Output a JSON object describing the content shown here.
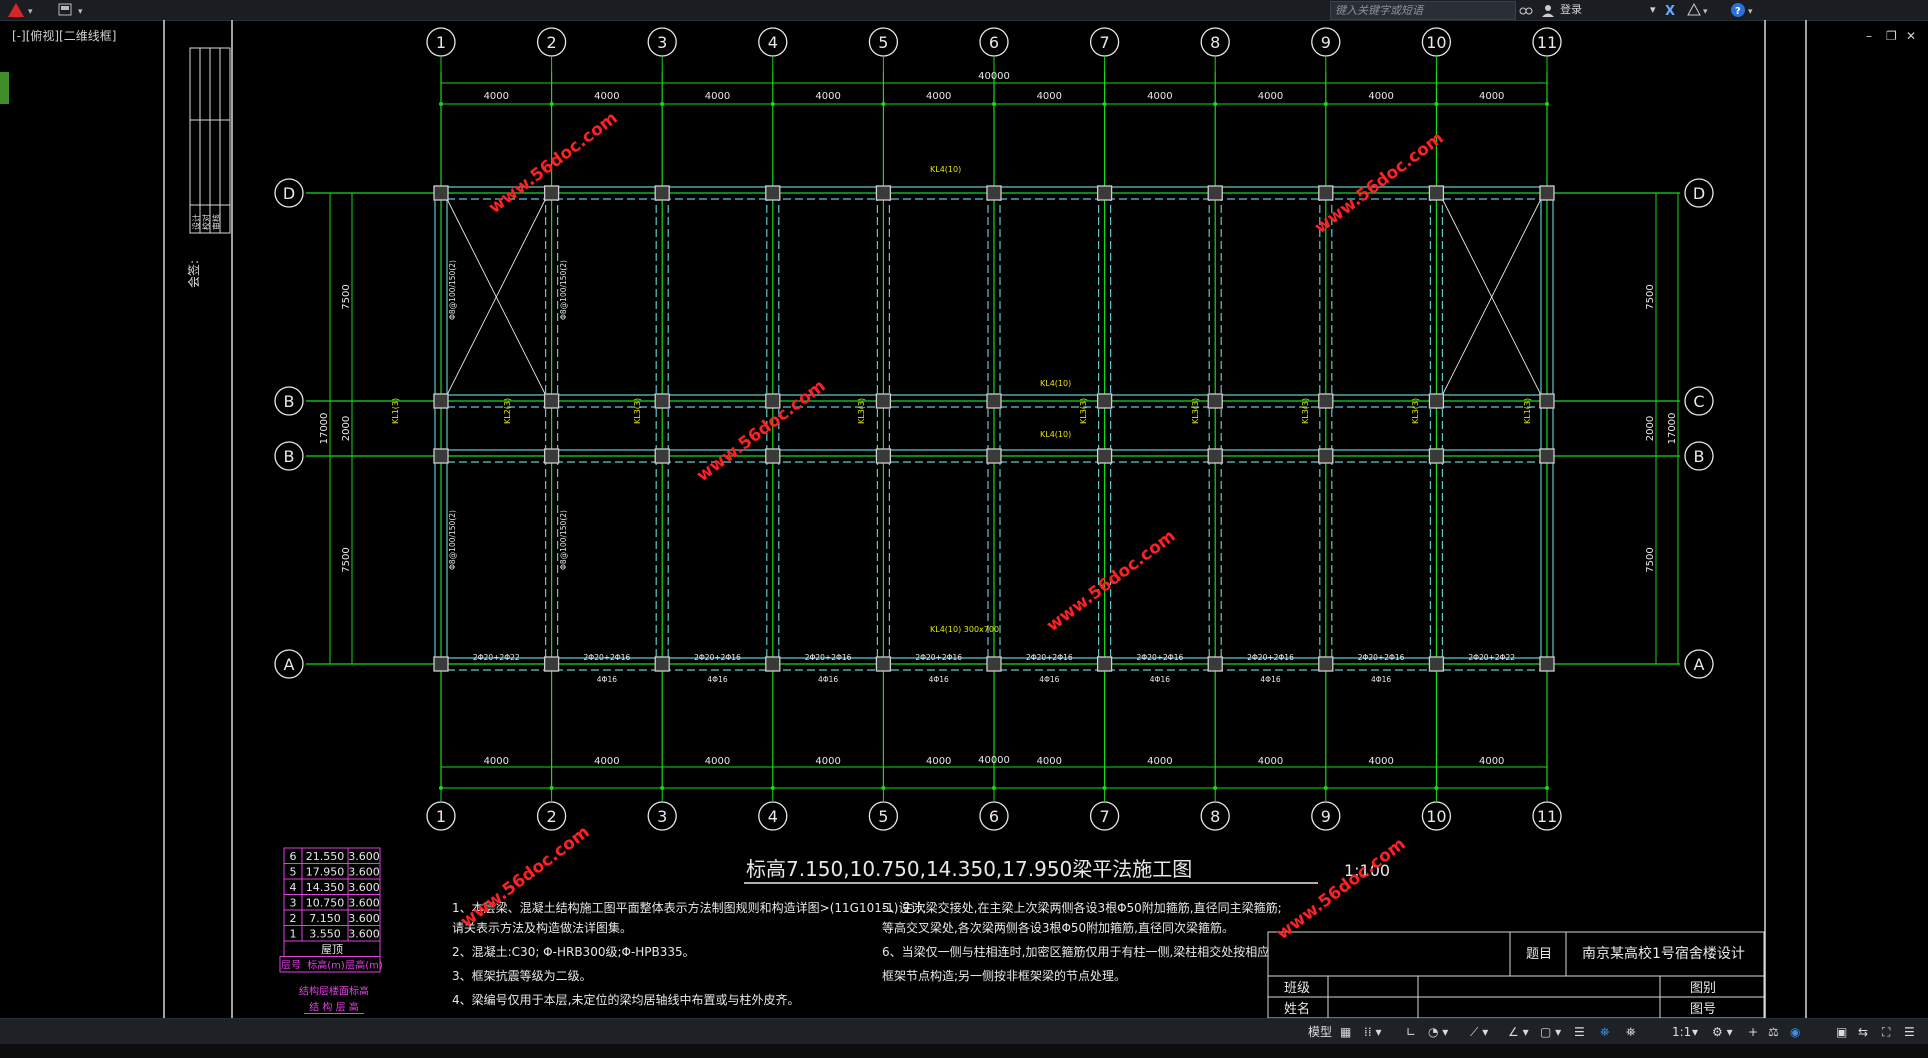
{
  "app": {
    "search_placeholder": "键入关键字或短语",
    "login_label": "登录",
    "view_label": "[-][俯视][二维线框]",
    "help_label": "?",
    "window_controls": [
      "_",
      "▫",
      "×"
    ]
  },
  "drawing": {
    "title": "标高7.150,10.750,14.350,17.950梁平法施工图",
    "scale": "1:100",
    "axis_columns": [
      "1",
      "2",
      "3",
      "4",
      "5",
      "6",
      "7",
      "8",
      "9",
      "10",
      "11"
    ],
    "axis_rows_left": [
      "D",
      "B",
      "B",
      "A"
    ],
    "axis_rows_right": [
      "D",
      "C",
      "B",
      "A"
    ],
    "span_dims": [
      "4000",
      "4000",
      "4000",
      "4000",
      "4000",
      "4000",
      "4000",
      "4000",
      "4000",
      "4000"
    ],
    "total_dim": "40000",
    "vertical_dims": [
      "7500",
      "2000",
      "7500"
    ],
    "total_vertical_dim": "17000",
    "watermark": "www.56doc.com",
    "beam_labels": [
      "KL4(10)",
      "KL4(10)",
      "KL4(10)",
      "KL4(10) 300x700",
      "KL3(3)",
      "KL3(3)",
      "KL3(3)",
      "KL3(3)",
      "KL3(3)",
      "KL3(3)",
      "KL1(3)",
      "KL2(3)",
      "KL1(3)"
    ],
    "bottom_rebar": [
      "2Φ20+2Φ22",
      "2Φ20+2Φ16",
      "2Φ20+2Φ16",
      "2Φ20+2Φ16",
      "2Φ20+2Φ16",
      "2Φ20+2Φ16",
      "2Φ20+2Φ16",
      "2Φ20+2Φ16",
      "2Φ20+2Φ16",
      "2Φ20+2Φ22"
    ],
    "bottom_rebar2": [
      "4Φ16",
      "4Φ16",
      "4Φ16",
      "4Φ16",
      "4Φ16",
      "4Φ16",
      "4Φ16",
      "4Φ16"
    ],
    "stirrup_labels": [
      "Φ8@100/150(2)",
      "Φ8@100/150(2)",
      "Φ8@100/150(2)",
      "Φ8@100/150(2)"
    ],
    "notes_left": [
      "1、本层梁、混凝土结构施工图平面整体表示方法制图规则和构造详图>(11G101-1)设计,",
      "   请关表示方法及构造做法详图集。",
      "2、混凝土:C30; Φ-HRB300级;Φ-HPB335。",
      "3、框架抗震等级为二级。",
      "4、梁编号仅用于本层,未定位的梁均居轴线中布置或与柱外皮齐。"
    ],
    "notes_right": [
      "5、主次梁交接处,在主梁上次梁两侧各设3根Φ50附加箍筋,直径同主梁箍筋;",
      "   等高交叉梁处,各次梁两侧各设3根Φ50附加箍筋,直径同次梁箍筋。",
      "6、当梁仅一侧与柱相连时,加密区箍筋仅用于有柱一侧,梁柱相交处按相应",
      "   框架节点构造;另一侧按非框架梁的节点处理。"
    ],
    "floor_table": {
      "rows": [
        {
          "floor": "6",
          "elev": "21.550",
          "height": "3.600"
        },
        {
          "floor": "5",
          "elev": "17.950",
          "height": "3.600"
        },
        {
          "floor": "4",
          "elev": "14.350",
          "height": "3.600"
        },
        {
          "floor": "3",
          "elev": "10.750",
          "height": "3.600"
        },
        {
          "floor": "2",
          "elev": "7.150",
          "height": "3.600"
        },
        {
          "floor": "1",
          "elev": "3.550",
          "height": "3.600"
        }
      ],
      "footer": "屋顶",
      "header": [
        "层号",
        "标高(m)",
        "层高(m)"
      ],
      "caption1": "结构层楼面标高",
      "caption2": "结 构 层 高"
    },
    "title_block": {
      "label_title": "题目",
      "project": "南京某高校1号宿舍楼设计",
      "class_label": "班级",
      "name_label": "姓名",
      "drawing_type_label": "图别",
      "drawing_no_label": "图号"
    },
    "side_label": "会签:",
    "stamp_labels": [
      "设计",
      "校对",
      "审核"
    ]
  },
  "statusbar": {
    "model_label": "模型",
    "scale": "1:1"
  },
  "colors": {
    "grid_green": "#19d819",
    "beam_cyan": "#5fc8c8",
    "axis_white": "#e8e8e8",
    "yellow": "#e6e600",
    "magenta": "#e040e0",
    "red_watermark": "#ff2020",
    "accent_blue": "#3a8ee6"
  }
}
